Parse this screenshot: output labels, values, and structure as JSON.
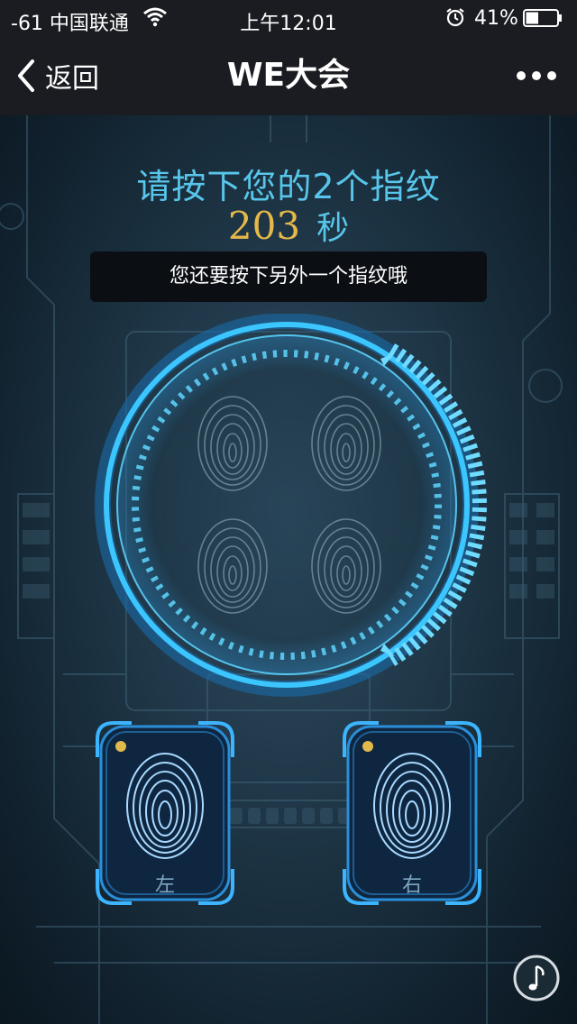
{
  "status_bar": {
    "carrier": "-61 中国联通",
    "time": "上午12:01",
    "battery_percent": "41%",
    "battery_level": 0.41
  },
  "nav": {
    "back_label": "返回",
    "title": "WE大会"
  },
  "content": {
    "prompt": "请按下您的2个指纹",
    "countdown_value": "203",
    "countdown_unit": "秒",
    "hint": "您还要按下另外一个指纹哦",
    "left_label": "左",
    "right_label": "右"
  },
  "colors": {
    "accent_cyan": "#58c6ea",
    "countdown_gold": "#e6b84a",
    "indicator_dot": "#e2b94c",
    "navbar_bg": "#1b1c21"
  },
  "icons": [
    "wifi-icon",
    "alarm-icon",
    "battery-icon",
    "back-chevron-icon",
    "more-icon",
    "fingerprint-icon",
    "music-icon"
  ]
}
